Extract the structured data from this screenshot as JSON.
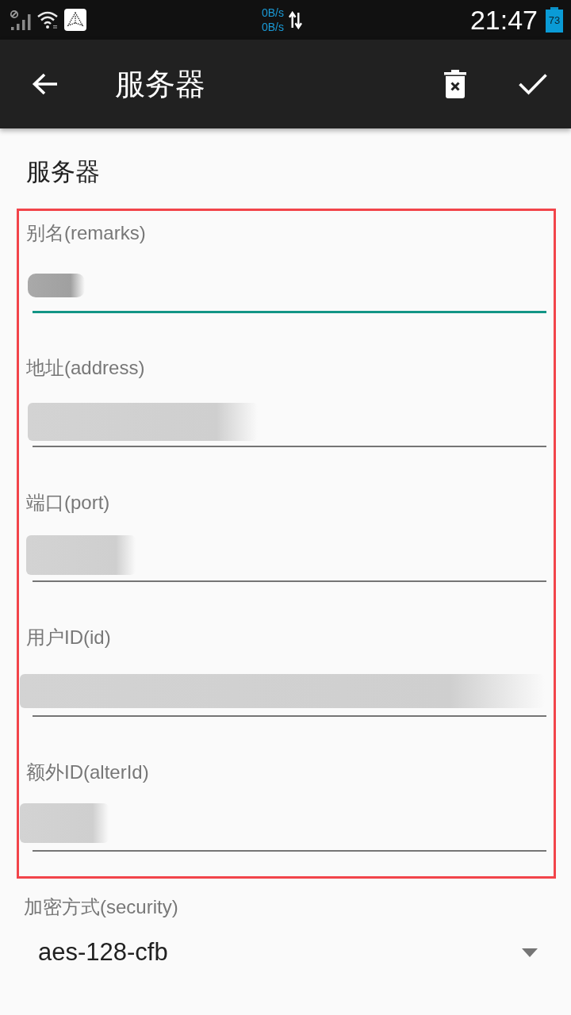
{
  "status_bar": {
    "net_up": "0B/s",
    "net_down": "0B/s",
    "time": "21:47",
    "battery": "73"
  },
  "app_bar": {
    "title": "服务器"
  },
  "form": {
    "heading": "服务器",
    "field_group": {
      "outlined": true,
      "fields": [
        {
          "label": "别名(remarks)",
          "focused": true,
          "redacted": true
        },
        {
          "label": "地址(address)",
          "focused": false,
          "redacted": true
        },
        {
          "label": "端口(port)",
          "focused": false,
          "redacted": true
        },
        {
          "label": "用户ID(id)",
          "focused": false,
          "redacted": true
        },
        {
          "label": "额外ID(alterId)",
          "focused": false,
          "redacted": true
        }
      ]
    },
    "security": {
      "label": "加密方式(security)",
      "value": "aes-128-cfb"
    }
  }
}
